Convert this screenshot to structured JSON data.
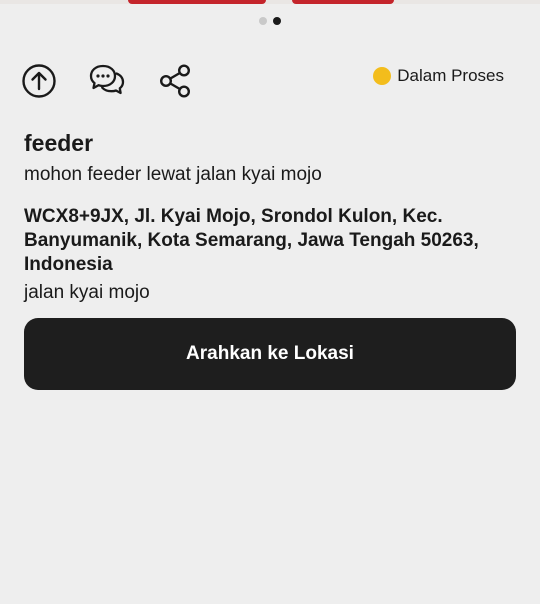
{
  "carousel": {
    "slide_count": 2,
    "active_index": 1
  },
  "actions": {
    "upvote_icon": "arrow-up-circle-icon",
    "comment_icon": "chat-bubbles-icon",
    "share_icon": "share-icon"
  },
  "status": {
    "label": "Dalam Proses",
    "color": "#f3bd1c"
  },
  "report": {
    "title": "feeder",
    "description": "mohon feeder lewat jalan kyai mojo",
    "address": "WCX8+9JX, Jl. Kyai Mojo, Srondol Kulon, Kec. Banyumanik, Kota Semarang, Jawa Tengah 50263, Indonesia",
    "landmark": "jalan kyai mojo"
  },
  "primary_button": {
    "label": "Arahkan ke Lokasi",
    "color": "#1e1e1e"
  }
}
